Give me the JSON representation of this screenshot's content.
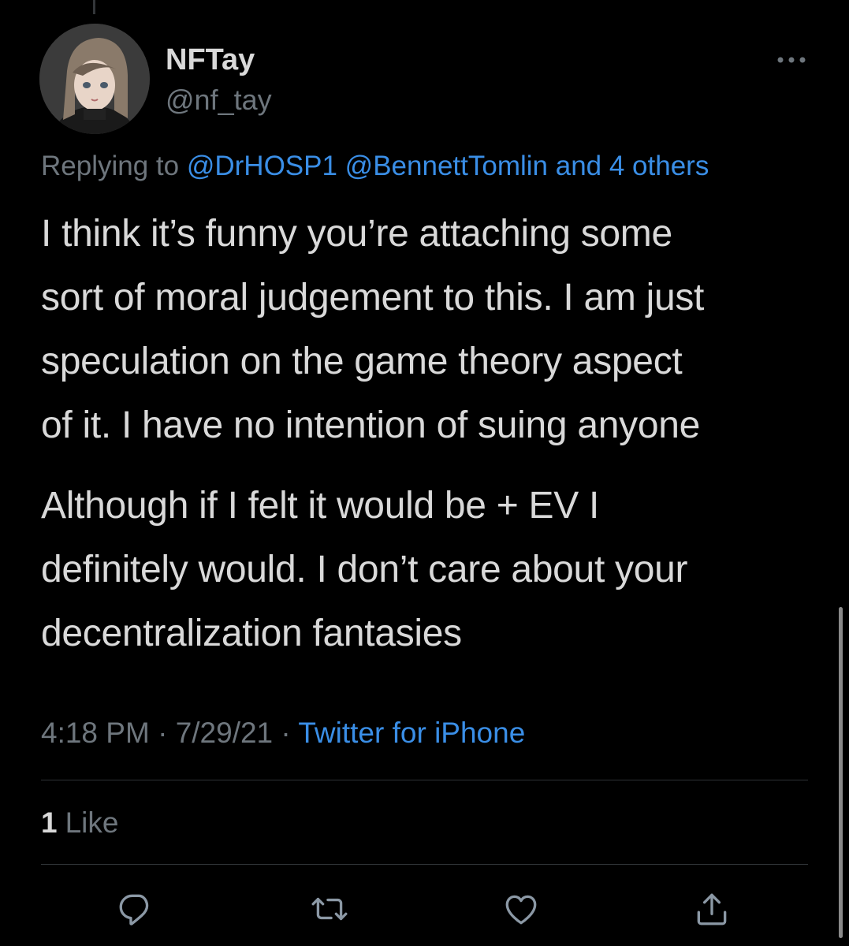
{
  "user": {
    "display_name": "NFTay",
    "handle": "@nf_tay"
  },
  "reply": {
    "prefix": "Replying to",
    "mentions": "@DrHOSP1 @BennettTomlin and 4 others"
  },
  "tweet": {
    "paragraph1": [
      "I think it’s funny you’re attaching some",
      "sort of moral judgement to this. I am just",
      "speculation on the game theory aspect",
      "of it. I have no intention of suing anyone"
    ],
    "paragraph2": [
      "Although if I felt it would be + EV I",
      "definitely would. I don’t care about your",
      "decentralization fantasies"
    ]
  },
  "meta": {
    "time": "4:18 PM",
    "separator": "·",
    "date": "7/29/21",
    "source": "Twitter for iPhone"
  },
  "stats": {
    "like_count": "1",
    "like_label": "Like"
  },
  "icons": {
    "more": "more-horizontal-icon",
    "reply": "reply-icon",
    "retweet": "retweet-icon",
    "like": "like-heart-icon",
    "share": "share-icon"
  },
  "colors": {
    "background": "#000000",
    "text": "#d9d9d9",
    "secondary": "#6e767d",
    "link": "#3a8ee6",
    "divider": "#2f3336"
  }
}
